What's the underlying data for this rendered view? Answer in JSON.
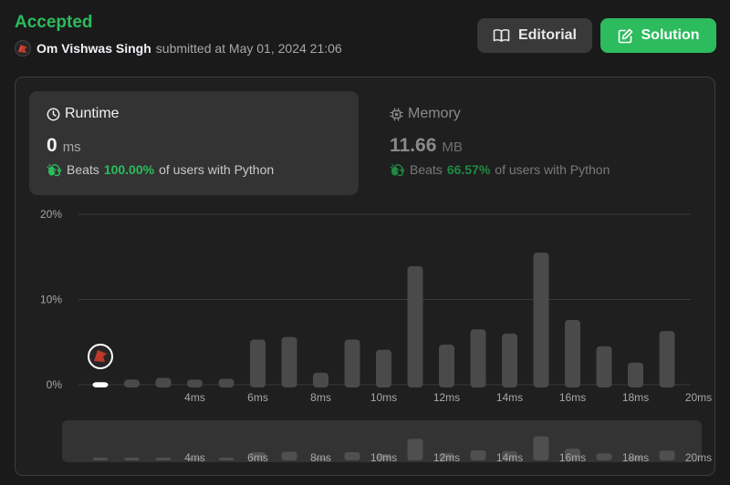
{
  "header": {
    "status": "Accepted",
    "user_name": "Om Vishwas Singh",
    "submitted_text": "submitted at May 01, 2024 21:06",
    "editorial_label": "Editorial",
    "solution_label": "Solution",
    "accent_color": "#2cbb5d"
  },
  "runtime": {
    "title": "Runtime",
    "value": "0",
    "unit": "ms",
    "beats_label": "Beats",
    "beats_pct": "100.00%",
    "beats_suffix": "of users with Python",
    "icon": "clock-icon"
  },
  "memory": {
    "title": "Memory",
    "value": "11.66",
    "unit": "MB",
    "beats_label": "Beats",
    "beats_pct": "66.57%",
    "beats_suffix": "of users with Python",
    "icon": "chip-icon"
  },
  "chart_data": {
    "type": "bar",
    "ylabel_ticks": [
      "20%",
      "10%",
      "0%"
    ],
    "y_tick_values": [
      20,
      10,
      0
    ],
    "ylim": [
      0,
      20
    ],
    "x_tick_labels": [
      "4ms",
      "6ms",
      "8ms",
      "10ms",
      "12ms",
      "14ms",
      "16ms",
      "18ms",
      "20ms"
    ],
    "x_tick_values": [
      4,
      6,
      8,
      10,
      12,
      14,
      16,
      18,
      20
    ],
    "x": [
      1,
      2,
      3,
      4,
      5,
      6,
      7,
      8,
      9,
      10,
      11,
      12,
      13,
      14,
      15,
      16,
      17,
      18,
      19,
      20
    ],
    "values": [
      0.3,
      0.6,
      0.8,
      0.6,
      0.7,
      5.3,
      5.6,
      1.4,
      5.3,
      4.1,
      13.9,
      4.7,
      6.5,
      6.0,
      15.5,
      7.6,
      4.5,
      2.6,
      6.3,
      0
    ],
    "highlight_x": 1,
    "grid": true,
    "overview_values": [
      0.3,
      0.6,
      0.8,
      0.6,
      0.7,
      5.3,
      5.6,
      1.4,
      5.3,
      4.1,
      13.9,
      4.7,
      6.5,
      6.0,
      15.5,
      7.6,
      4.5,
      2.6,
      6.3,
      0
    ]
  }
}
